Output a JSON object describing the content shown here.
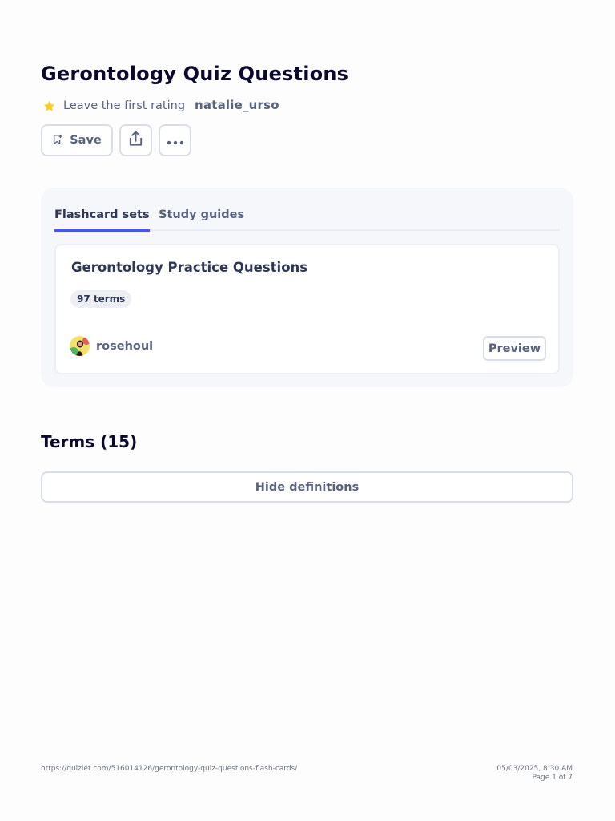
{
  "set": {
    "title": "Gerontology Quiz Questions",
    "rating_text": "Leave the first rating",
    "author": "natalie_urso"
  },
  "actions": {
    "save_label": "Save",
    "share_icon": "share-icon",
    "more_icon": "more-horizontal-icon"
  },
  "related": {
    "tabs": [
      {
        "label": "Flashcard sets",
        "active": true
      },
      {
        "label": "Study guides",
        "active": false
      }
    ],
    "card": {
      "title": "Gerontology Practice Questions",
      "terms_badge": "97 terms",
      "creator": "rosehoul",
      "preview_label": "Preview"
    }
  },
  "terms": {
    "heading": "Terms (15)",
    "hide_definitions_label": "Hide definitions"
  },
  "footer": {
    "url": "https://quizlet.com/516014126/gerontology-quiz-questions-flash-cards/",
    "datetime": "05/03/2025, 8:30 AM",
    "page": "Page 1 of 7"
  },
  "colors": {
    "accent": "#4255ff",
    "star": "#ffcd1f",
    "text_primary": "#0a092d",
    "text_secondary": "#586380",
    "panel_bg": "#f6f7fb"
  }
}
